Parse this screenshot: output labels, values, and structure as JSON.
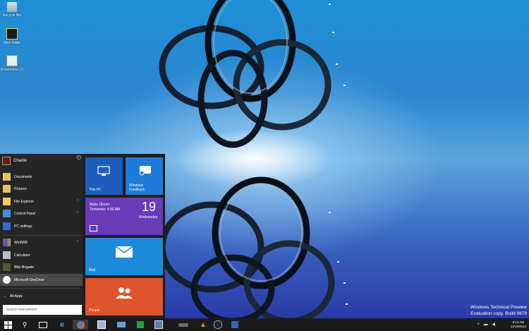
{
  "desktop": {
    "icons": [
      {
        "label": "Recycle Bin",
        "icon": "recycle-bin-icon"
      },
      {
        "label": "New folder",
        "icon": "folder-icon"
      },
      {
        "label": "Screenshot (2)",
        "icon": "screenshot-file-icon"
      }
    ],
    "watermark": {
      "line1": "Windows Technical Preview",
      "line2": "Evaluation copy. Build 9879"
    }
  },
  "start_menu": {
    "user_name": "Charlie",
    "items": [
      {
        "label": "Documents",
        "icon": "documents-folder-icon"
      },
      {
        "label": "Pictures",
        "icon": "pictures-folder-icon"
      },
      {
        "label": "File Explorer",
        "icon": "file-explorer-icon",
        "arrow": "›"
      },
      {
        "label": "Control Panel",
        "icon": "control-panel-icon",
        "arrow": "›"
      },
      {
        "label": "PC settings",
        "icon": "pc-settings-icon"
      },
      {
        "label": "WinRAR",
        "icon": "winrar-icon",
        "arrow": "›"
      },
      {
        "label": "Calculator",
        "icon": "calculator-icon"
      },
      {
        "label": "Blitz Brigade",
        "icon": "blitz-brigade-icon"
      },
      {
        "label": "Microsoft OneDrive",
        "icon": "onedrive-icon"
      }
    ],
    "all_apps": "All Apps",
    "search_placeholder": "Search everywhere",
    "tiles": {
      "this_pc": "This PC",
      "feedback_line1": "Windows",
      "feedback_line2": "Feedback",
      "calendar_event": "Make Dinner",
      "calendar_time": "Tomorrow: 4:30 AM",
      "calendar_date": "19",
      "calendar_day": "Wednesday",
      "mail": "Mail",
      "people": "People"
    },
    "colors": {
      "this_pc": "#1c5dbb",
      "feedback": "#1e7ad8",
      "calendar": "#6a3bb8",
      "mail": "#1c8adb",
      "people": "#e0532b"
    }
  },
  "taskbar": {
    "apps": [
      "start-button",
      "search-icon",
      "task-view-icon",
      "internet-explorer-icon",
      "firefox-icon",
      "explorer-icon",
      "network-icon",
      "store-icon",
      "paint-icon",
      "car-game-icon",
      "vlc-icon",
      "steam-icon",
      "media-icon"
    ],
    "clock_time": "8:13 AM",
    "clock_date": "11/19/2014"
  }
}
